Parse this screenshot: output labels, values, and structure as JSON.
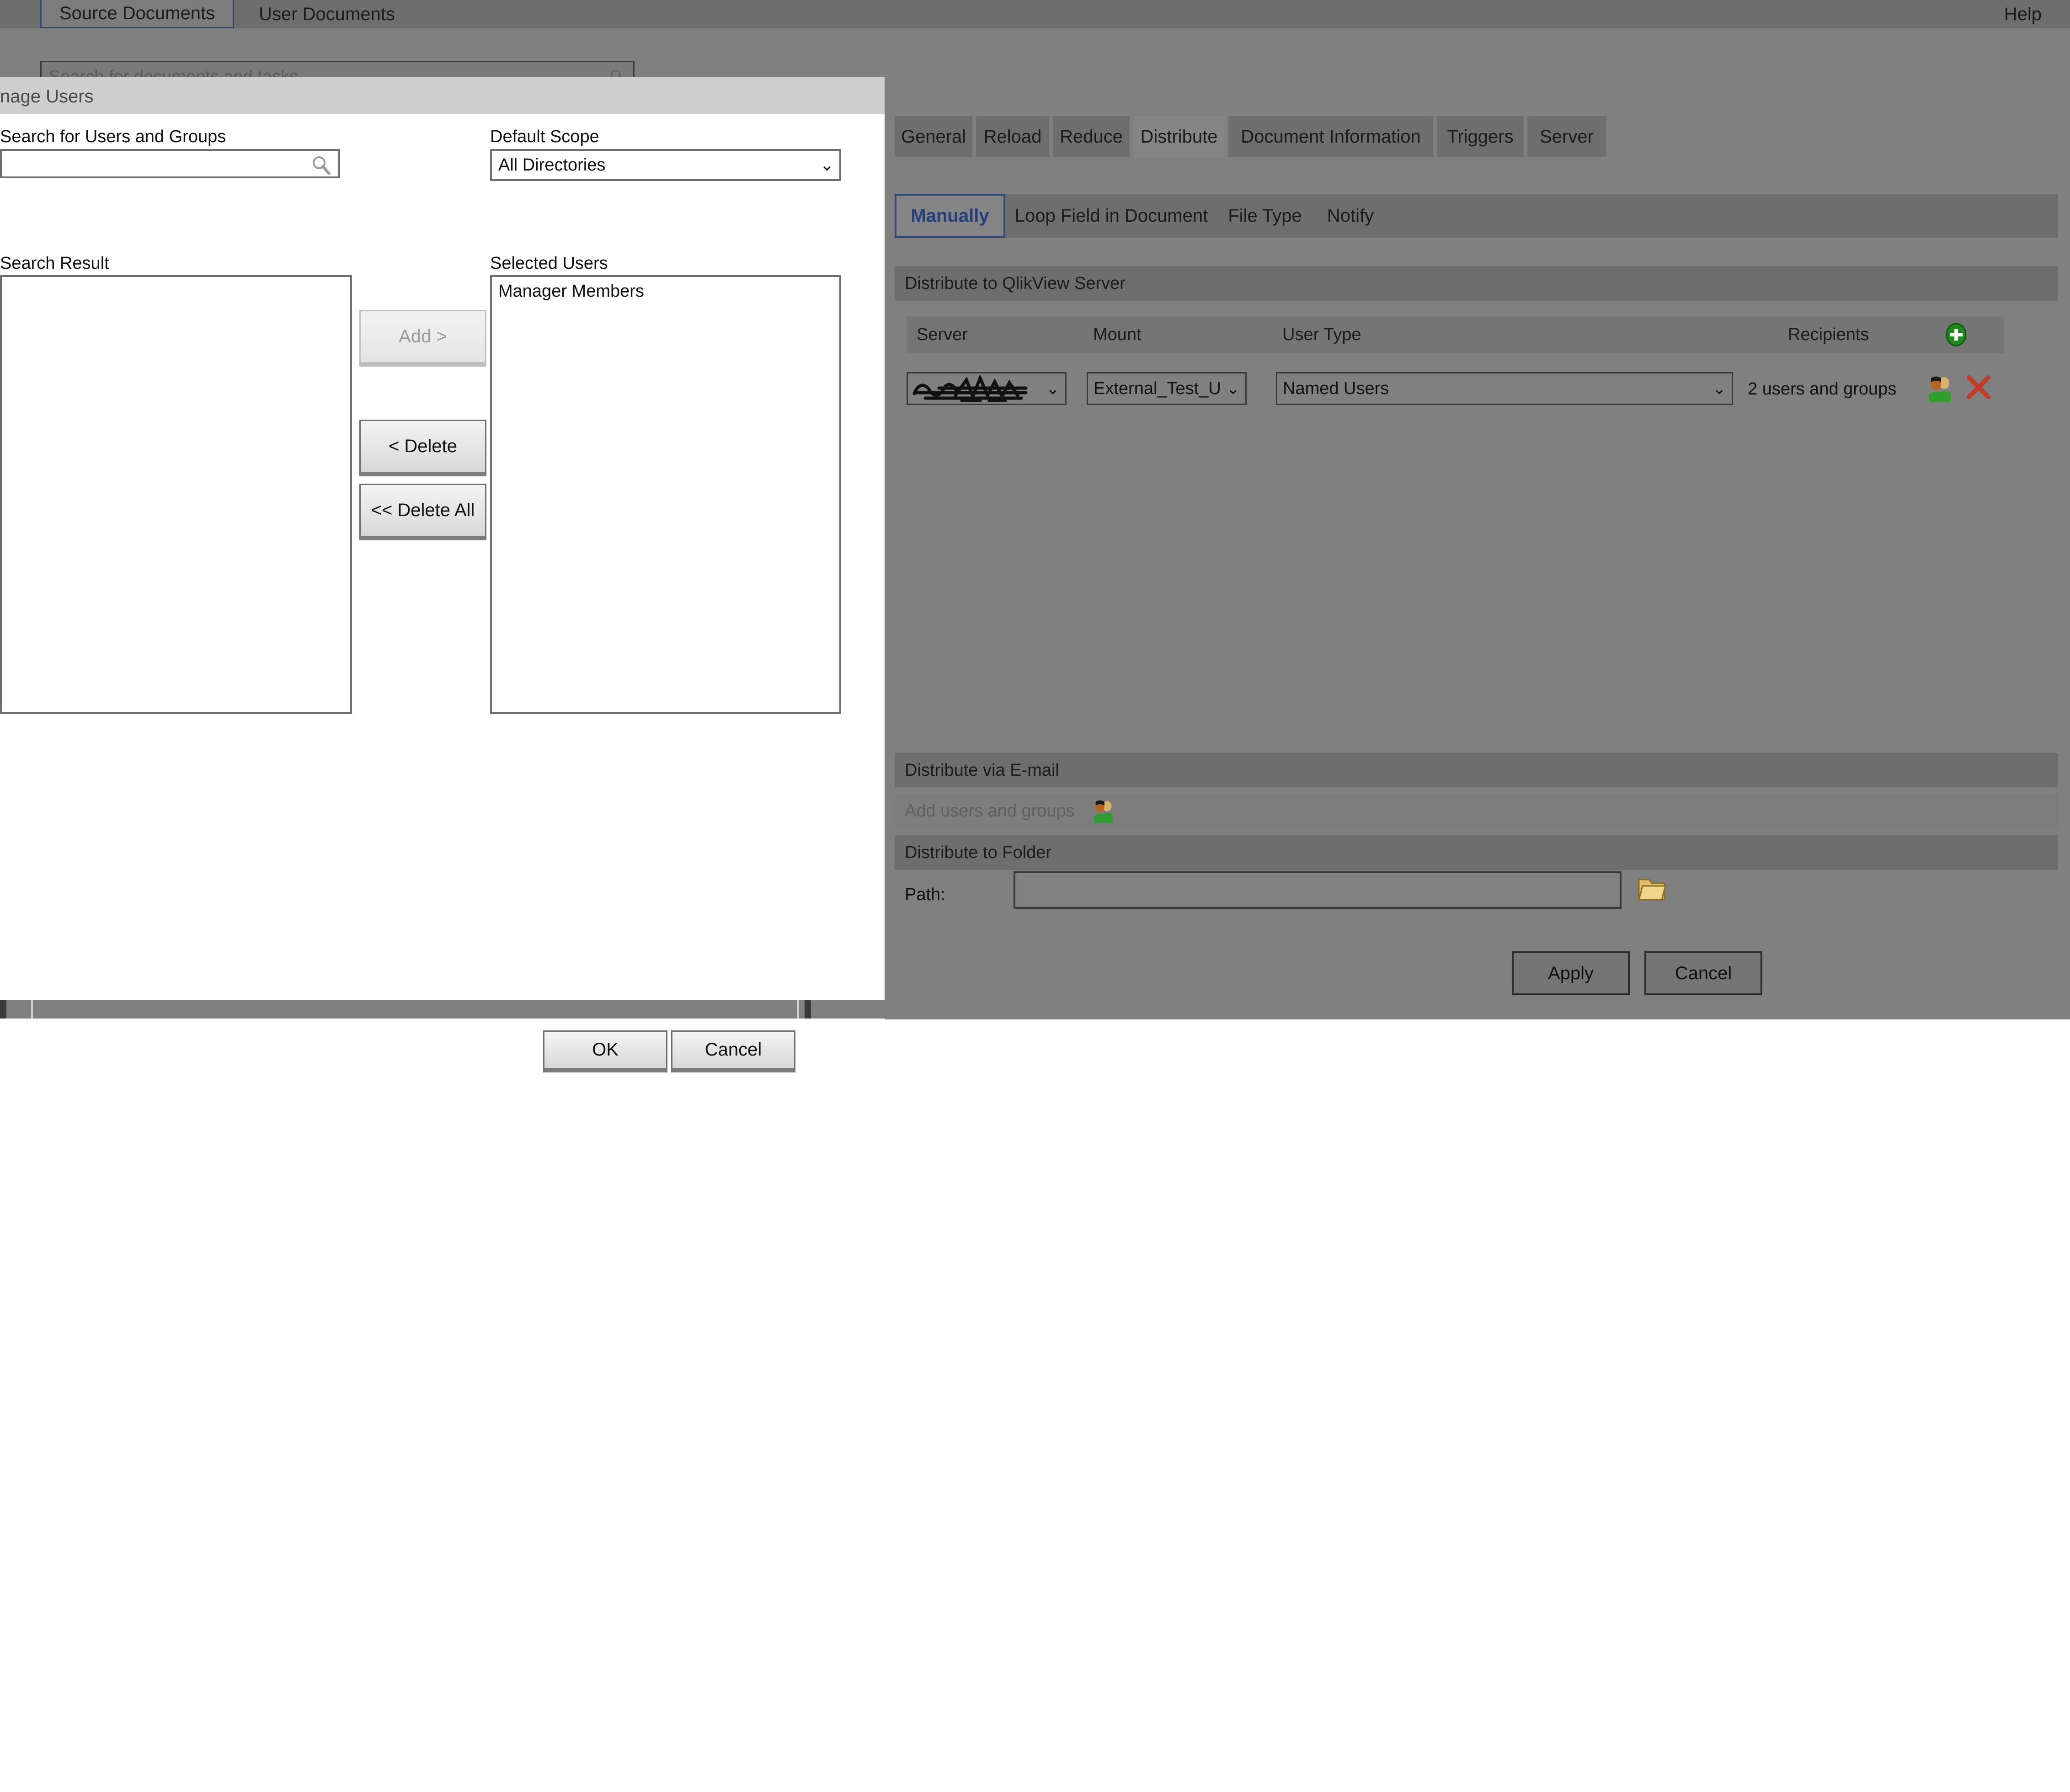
{
  "qmc": {
    "top_tabs": [
      {
        "label": "Source Documents",
        "selected": true
      },
      {
        "label": "User Documents",
        "selected": false
      }
    ],
    "help_label": "Help",
    "document_search": {
      "placeholder": "Search for documents and tasks",
      "value": "",
      "icon": "search-icon"
    }
  },
  "task": {
    "main_tabs": [
      {
        "label": "General",
        "selected": false
      },
      {
        "label": "Reload",
        "selected": false
      },
      {
        "label": "Reduce",
        "selected": false
      },
      {
        "label": "Distribute",
        "selected": true
      },
      {
        "label": "Document Information",
        "selected": false
      },
      {
        "label": "Triggers",
        "selected": false
      },
      {
        "label": "Server",
        "selected": false
      }
    ],
    "sub_tabs": [
      {
        "label": "Manually",
        "selected": true
      },
      {
        "label": "Loop Field in Document",
        "selected": false
      },
      {
        "label": "File Type",
        "selected": false
      },
      {
        "label": "Notify",
        "selected": false
      }
    ],
    "qvs_section": {
      "title": "Distribute to QlikView Server",
      "columns": [
        "Server",
        "Mount",
        "User Type",
        "Recipients"
      ],
      "add_icon": "green-plus-icon",
      "rows": [
        {
          "server": "",
          "server_redacted": true,
          "mount": "External_Test_U",
          "user_type": "Named Users",
          "recipients": "2 users and groups",
          "recipients_icon": "users-icon",
          "delete_icon": "red-x-icon"
        }
      ]
    },
    "email_section": {
      "title": "Distribute via E-mail",
      "add_label": "Add users and groups",
      "add_icon": "users-icon"
    },
    "folder_section": {
      "title": "Distribute to Folder",
      "path_label": "Path:",
      "path_value": "",
      "browse_icon": "folder-icon"
    },
    "buttons": {
      "apply": "Apply",
      "cancel": "Cancel"
    }
  },
  "modal": {
    "title": "nage Users",
    "search_label": "Search for Users and Groups",
    "search_value": "",
    "search_icon": "search-icon",
    "scope_label": "Default Scope",
    "scope_value": "All Directories",
    "search_result_label": "Search Result",
    "search_result_items": [],
    "selected_users_label": "Selected Users",
    "selected_users_items": [
      "Manager Members"
    ],
    "transfer_buttons": [
      {
        "label": "Add >",
        "name": "add-button",
        "disabled": true
      },
      {
        "label": "< Delete",
        "name": "delete-button",
        "disabled": false
      },
      {
        "label": "<< Delete All",
        "name": "delete-all-button",
        "disabled": false
      }
    ],
    "ok_label": "OK",
    "cancel_label": "Cancel"
  },
  "colors": {
    "window_bg": "#808080",
    "tabbar_bg": "#6e6e6e",
    "accent_blue": "#2d4a7a",
    "modal_titlebar": "#cecece",
    "green_plus": "#1e8a1e",
    "red_x": "#c13b2a"
  }
}
